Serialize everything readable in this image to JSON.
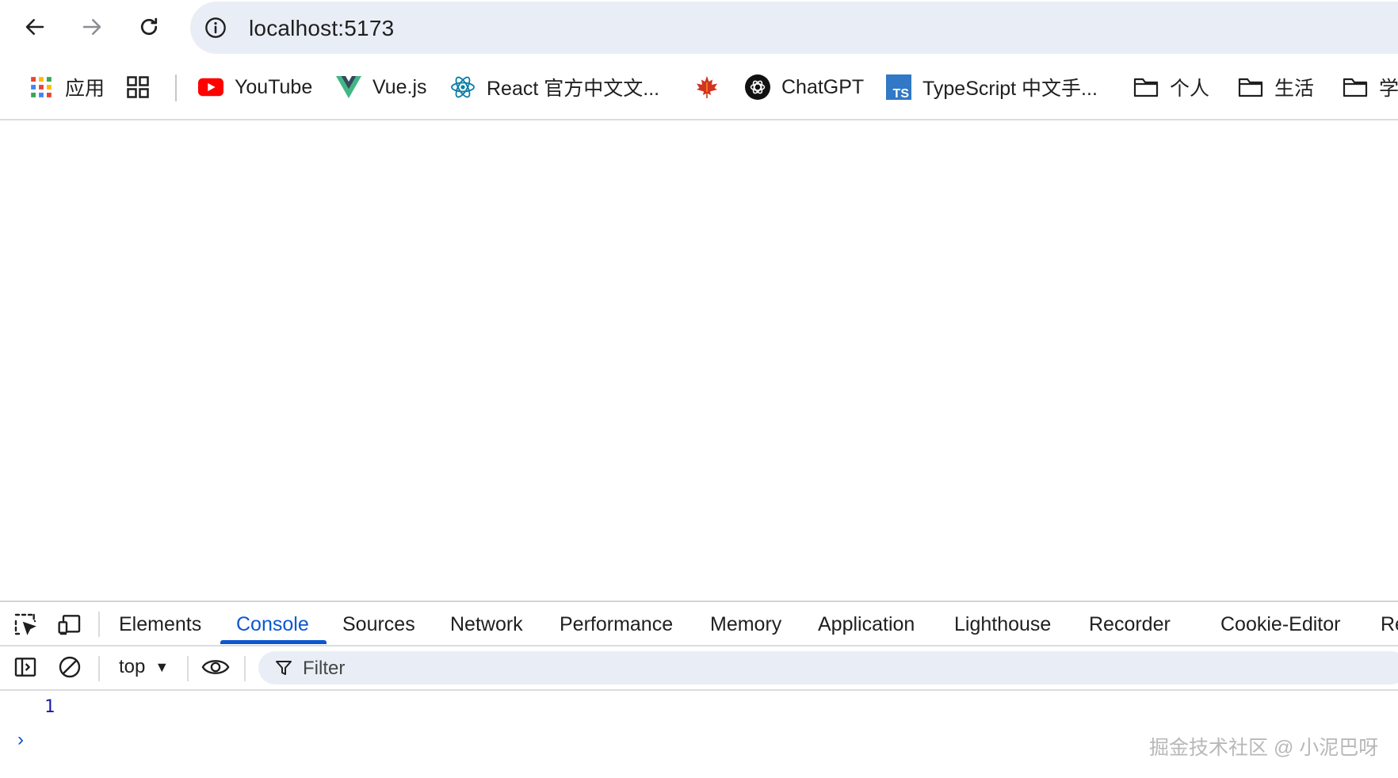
{
  "browser": {
    "address_bar": {
      "url": "localhost:5173"
    }
  },
  "bookmarks": [
    {
      "label": "应用",
      "icon": "apps-grid-icon"
    },
    {
      "label": "",
      "icon": "grid-squares-icon"
    },
    {
      "label": "YouTube",
      "icon": "youtube-icon"
    },
    {
      "label": "Vue.js",
      "icon": "vue-icon"
    },
    {
      "label": "React 官方中文文...",
      "icon": "react-icon"
    },
    {
      "label": "",
      "icon": "maple-leaf-icon"
    },
    {
      "label": "ChatGPT",
      "icon": "chatgpt-icon"
    },
    {
      "label": "TypeScript 中文手...",
      "icon": "typescript-icon",
      "icon_text": "TS"
    },
    {
      "label": "个人",
      "icon": "folder-icon"
    },
    {
      "label": "生活",
      "icon": "folder-icon"
    },
    {
      "label": "学",
      "icon": "folder-icon"
    }
  ],
  "devtools": {
    "tabs": [
      "Elements",
      "Console",
      "Sources",
      "Network",
      "Performance",
      "Memory",
      "Application",
      "Lighthouse",
      "Recorder",
      "Cookie-Editor",
      "Re"
    ],
    "active_tab": "Console",
    "console": {
      "context": "top",
      "filter_placeholder": "Filter",
      "log_value": "1",
      "prompt": "›"
    }
  },
  "watermark": "掘金技术社区 @ 小泥巴呀",
  "colors": {
    "accent": "#0b57d0",
    "omnibox_bg": "#e9eef6",
    "youtube_red": "#ff0000",
    "vue_green": "#41b883",
    "react_blue": "#087ea4",
    "typescript_blue": "#3178c6"
  }
}
